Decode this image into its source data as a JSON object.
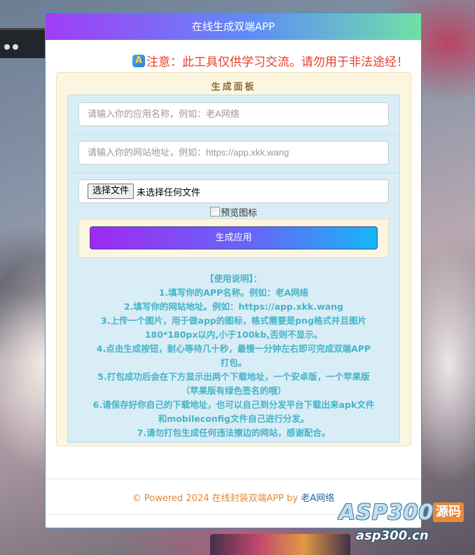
{
  "header": {
    "title": "在线生成双端APP"
  },
  "notice": {
    "icon_letter": "A",
    "text": "注意：此工具仅供学习交流。请勿用于非法途经！"
  },
  "panel": {
    "title": "生成面板",
    "app_name_placeholder": "请输入你的应用名称，例如：老A网络",
    "site_url_placeholder": "请输入你的网站地址，例如：https://app.xkk.wang",
    "file_button_label": "选择文件",
    "file_status": "未选择任何文件",
    "preview_alt": "预览图标",
    "submit_label": "生成应用"
  },
  "instructions": {
    "lines": [
      "【使用说明】：",
      "1.填写你的APP名称。例如：老A网络",
      "2.填写你的网站地址。例如：https://app.xkk.wang",
      "3.上传一个图片，用于做app的图标，格式需要是png格式并且图片",
      "180*180px以内,小于100kb,否则不显示。",
      "4.点击生成按钮，耐心等待几十秒，最慢一分钟左右即可完成双端APP",
      "打包。",
      "5.打包成功后会在下方显示出两个下载地址，一个安卓版，一个苹果版",
      "（苹果版有绿色签名的哦）",
      "6.请保存好你自己的下载地址，也可以自己到分发平台下载出来apk文件",
      "和mobileconfig文件自己进行分发。",
      "7.请勿打包生成任何违法擦边的网站，感谢配合。"
    ]
  },
  "footer": {
    "prefix": "© Powered 2024 在线封装双端APP by ",
    "link_text": "老A网络"
  },
  "watermark": {
    "main": "ASP300",
    "tag": "源码",
    "url": "asp300.cn"
  }
}
